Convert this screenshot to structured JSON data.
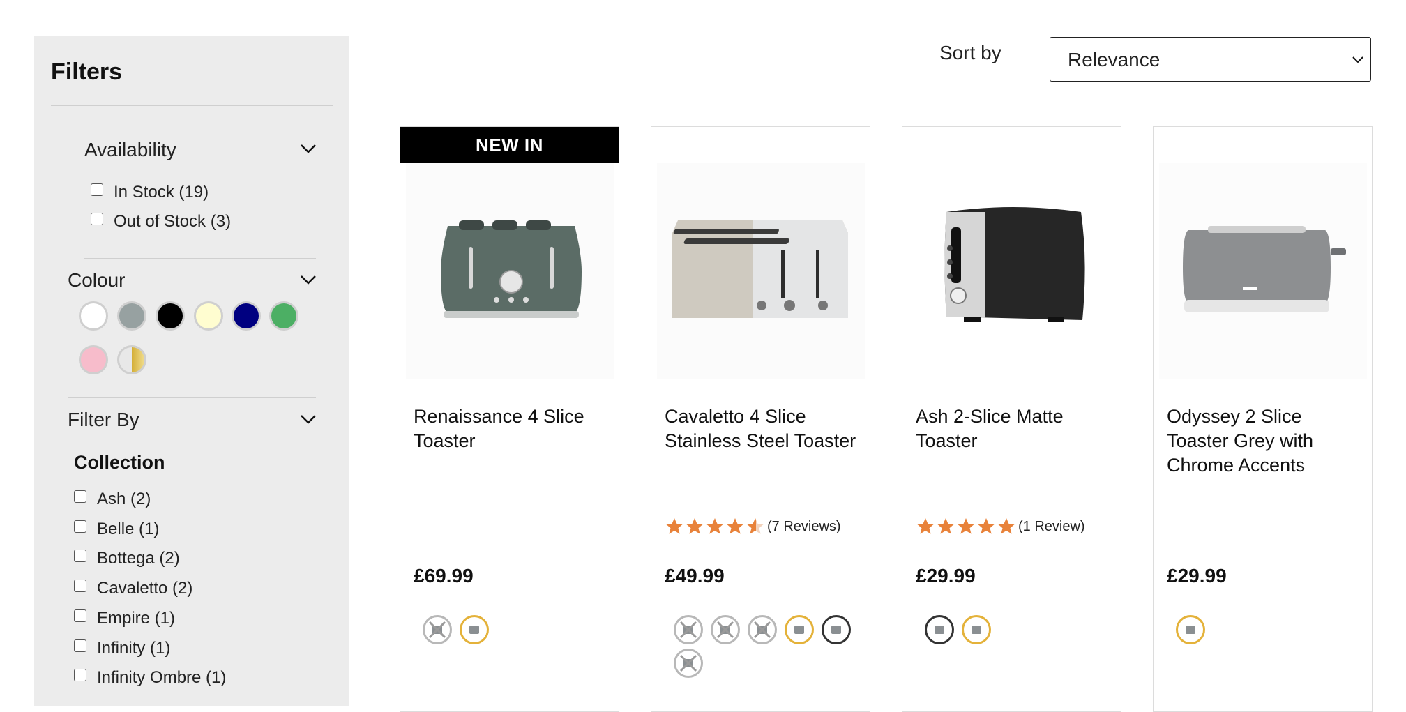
{
  "filters": {
    "title": "Filters",
    "availability": {
      "label": "Availability",
      "options": [
        {
          "label": "In Stock (19)"
        },
        {
          "label": "Out of Stock (3)"
        }
      ]
    },
    "colour": {
      "label": "Colour",
      "swatches": [
        {
          "name": "white",
          "color": "#ffffff"
        },
        {
          "name": "grey",
          "color": "#97a1a1"
        },
        {
          "name": "black",
          "color": "#000000"
        },
        {
          "name": "cream",
          "color": "#fffdd0"
        },
        {
          "name": "navy",
          "color": "#000080"
        },
        {
          "name": "green",
          "color": "#4caf64"
        },
        {
          "name": "pink",
          "color": "#f7bccb"
        },
        {
          "name": "chrome-gold",
          "color": "#d4af37"
        }
      ]
    },
    "filter_by": {
      "label": "Filter By",
      "collection_heading": "Collection",
      "options": [
        {
          "label": "Ash (2)"
        },
        {
          "label": "Belle (1)"
        },
        {
          "label": "Bottega (2)"
        },
        {
          "label": "Cavaletto (2)"
        },
        {
          "label": "Empire (1)"
        },
        {
          "label": "Infinity (1)"
        },
        {
          "label": "Infinity Ombre (1)"
        }
      ]
    }
  },
  "sort": {
    "label": "Sort by",
    "value": "Relevance"
  },
  "products": [
    {
      "badge": "NEW IN",
      "name": "Renaissance 4 Slice Toaster",
      "price": "£69.99",
      "rating": null,
      "reviews": "",
      "variants": [
        "out-of-stock",
        "available"
      ]
    },
    {
      "badge": "",
      "name": "Cavaletto 4 Slice Stainless Steel Toaster",
      "price": "£49.99",
      "rating": 4.5,
      "reviews": "(7 Reviews)",
      "variants": [
        "out-of-stock",
        "out-of-stock",
        "out-of-stock",
        "available",
        "selected",
        "out-of-stock"
      ]
    },
    {
      "badge": "",
      "name": "Ash 2-Slice Matte Toaster",
      "price": "£29.99",
      "rating": 5,
      "reviews": "(1 Review)",
      "variants": [
        "selected",
        "available"
      ]
    },
    {
      "badge": "",
      "name": "Odyssey 2 Slice Toaster Grey with Chrome Accents",
      "price": "£29.99",
      "rating": null,
      "reviews": "",
      "variants": [
        "available"
      ]
    }
  ],
  "colors": {
    "star": "#e8823a",
    "badge_bg": "#000000",
    "sidebar_bg": "#ececec",
    "variant_available_ring": "#e4b23a",
    "variant_oos_ring": "#b8b8b8"
  }
}
